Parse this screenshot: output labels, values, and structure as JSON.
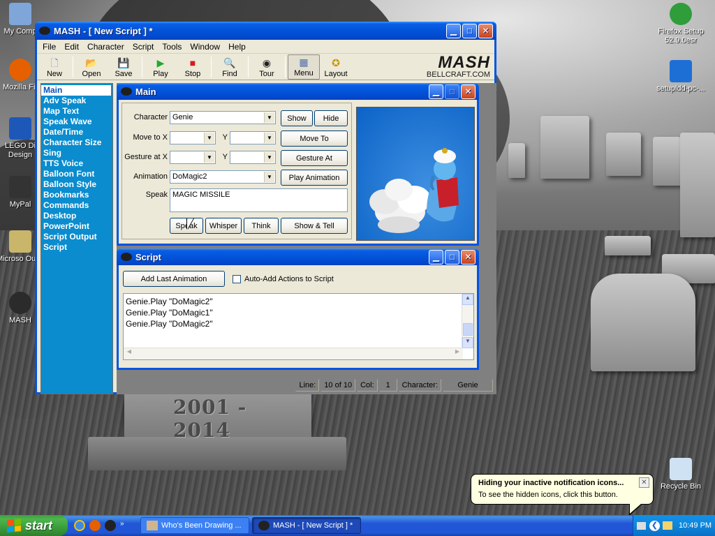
{
  "desktop": {
    "icons_left": [
      {
        "label": "My Comp",
        "color": "#7fa6d9"
      },
      {
        "label": "Mozilla Fir",
        "color": "#e66000"
      },
      {
        "label": "LEGO Di Design",
        "color": "#1d58b8"
      },
      {
        "label": "MyPal",
        "color": "#333333"
      },
      {
        "label": "Microso Outlo",
        "color": "#c9b66a"
      },
      {
        "label": "MASH",
        "color": "#2b2b2b"
      }
    ],
    "icons_right": [
      {
        "label": "Firefox Setup 52.9.0esr",
        "color": "#2f9d3a"
      },
      {
        "label": "setupldd-pc-...",
        "color": "#1d6fd6"
      },
      {
        "label": "Recycle Bin",
        "color": "#cfe2f3"
      }
    ],
    "tombstone_text": "2001 - 2014"
  },
  "main_window": {
    "title": "MASH - [ New Script ] *",
    "menu": [
      "File",
      "Edit",
      "Character",
      "Script",
      "Tools",
      "Window",
      "Help"
    ],
    "toolbar": [
      {
        "label": "New",
        "icon": "new-icon",
        "glyph": "🗋"
      },
      {
        "label": "Open",
        "icon": "open-icon",
        "glyph": "📂"
      },
      {
        "label": "Save",
        "icon": "save-icon",
        "glyph": "💾"
      },
      {
        "label": "Play",
        "icon": "play-icon",
        "glyph": "▶"
      },
      {
        "label": "Stop",
        "icon": "stop-icon",
        "glyph": "■"
      },
      {
        "label": "Find",
        "icon": "find-icon",
        "glyph": "🔍"
      },
      {
        "label": "Tour",
        "icon": "tour-icon",
        "glyph": "◉"
      },
      {
        "label": "Menu",
        "icon": "menu-icon",
        "glyph": "▦"
      },
      {
        "label": "Layout",
        "icon": "layout-icon",
        "glyph": "✪"
      }
    ],
    "logo": {
      "big": "MASH",
      "small": "BELLCRAFT.COM"
    },
    "nav": [
      "Main",
      "Adv Speak",
      "Map Text",
      "Speak Wave",
      "Date/Time",
      "Character Size",
      "Sing",
      "TTS Voice",
      "Balloon Font",
      "Balloon Style",
      "Bookmarks",
      "Commands",
      "Desktop",
      "PowerPoint",
      "Script Output",
      "Script"
    ],
    "nav_selected": "Main",
    "status": {
      "line_label": "Line:",
      "line_value": "10 of 10",
      "col_label": "Col:",
      "col_value": "1",
      "char_label": "Character:",
      "char_value": "Genie"
    }
  },
  "main_panel": {
    "title": "Main",
    "character_label": "Character",
    "character_value": "Genie",
    "move_label": "Move to X",
    "y_label": "Y",
    "gesture_label": "Gesture at X",
    "animation_label": "Animation",
    "animation_value": "DoMagic2",
    "speak_label": "Speak",
    "speak_value": "MAGIC MISSILE",
    "buttons": {
      "show": "Show",
      "hide": "Hide",
      "move_to": "Move To",
      "gesture_at": "Gesture At",
      "play_animation": "Play Animation",
      "speak": "Speak",
      "whisper": "Whisper",
      "think": "Think",
      "show_tell": "Show & Tell"
    }
  },
  "script_panel": {
    "title": "Script",
    "add_last_animation": "Add Last Animation",
    "auto_add_label": "Auto-Add Actions to Script",
    "auto_add_checked": false,
    "lines": [
      "Genie.Play \"DoMagic2\"",
      "Genie.Play \"DoMagic1\"",
      "Genie.Play \"DoMagic2\""
    ]
  },
  "taskbar": {
    "start": "start",
    "tasks": [
      {
        "label": "Who's Been Drawing ...",
        "active": false
      },
      {
        "label": "MASH - [ New Script ] *",
        "active": true
      }
    ],
    "clock": "10:49 PM"
  },
  "balloon": {
    "title": "Hiding your inactive notification icons...",
    "text": "To see the hidden icons, click this button."
  }
}
